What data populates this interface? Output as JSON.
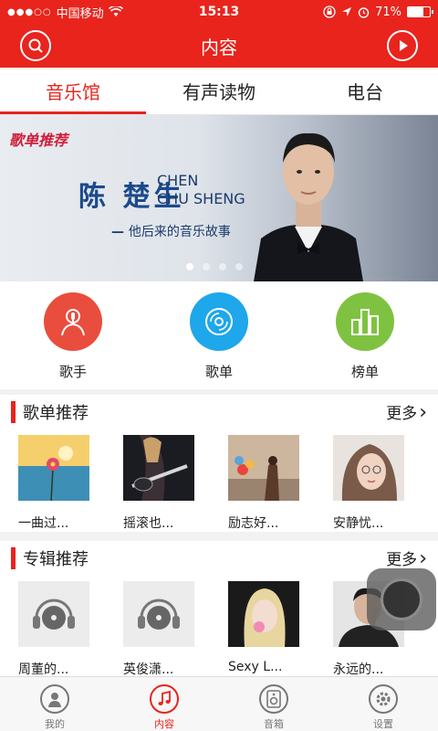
{
  "status_bar": {
    "carrier": "中国移动",
    "time": "15:13",
    "battery": "71%",
    "battery_level": 0.71
  },
  "header": {
    "title": "内容",
    "left_icon": "search-icon",
    "right_icon": "play-icon"
  },
  "tabs": [
    {
      "label": "音乐馆",
      "active": true
    },
    {
      "label": "有声读物",
      "active": false
    },
    {
      "label": "电台",
      "active": false
    }
  ],
  "banner": {
    "tag": "歌单推荐",
    "name": "陈 楚生",
    "name_en_line1": "CHEN",
    "name_en_line2": "CHU SHENG",
    "subtitle": "他后来的音乐故事",
    "page_count": 4,
    "active_page": 1
  },
  "categories": [
    {
      "label": "歌手",
      "icon": "singer-icon",
      "color": "#e94d3d"
    },
    {
      "label": "歌单",
      "icon": "disc-icon",
      "color": "#1ea7ea"
    },
    {
      "label": "榜单",
      "icon": "chart-icon",
      "color": "#7fc241"
    }
  ],
  "playlist_section": {
    "title": "歌单推荐",
    "more": "更多",
    "items": [
      {
        "title": "一曲过..."
      },
      {
        "title": "摇滚也..."
      },
      {
        "title": "励志好..."
      },
      {
        "title": "安静忧..."
      }
    ]
  },
  "album_section": {
    "title": "专辑推荐",
    "more": "更多",
    "items": [
      {
        "title": "周董的..."
      },
      {
        "title": "英俊潇..."
      },
      {
        "title": "Sexy L..."
      },
      {
        "title": "永远的..."
      }
    ]
  },
  "bottom_nav": [
    {
      "label": "我的",
      "icon": "user-icon",
      "active": false
    },
    {
      "label": "内容",
      "icon": "music-note-icon",
      "active": true
    },
    {
      "label": "音箱",
      "icon": "speaker-icon",
      "active": false
    },
    {
      "label": "设置",
      "icon": "settings-gear-icon",
      "active": false
    }
  ],
  "colors": {
    "accent": "#e8241d",
    "nav_inactive": "#777777"
  }
}
